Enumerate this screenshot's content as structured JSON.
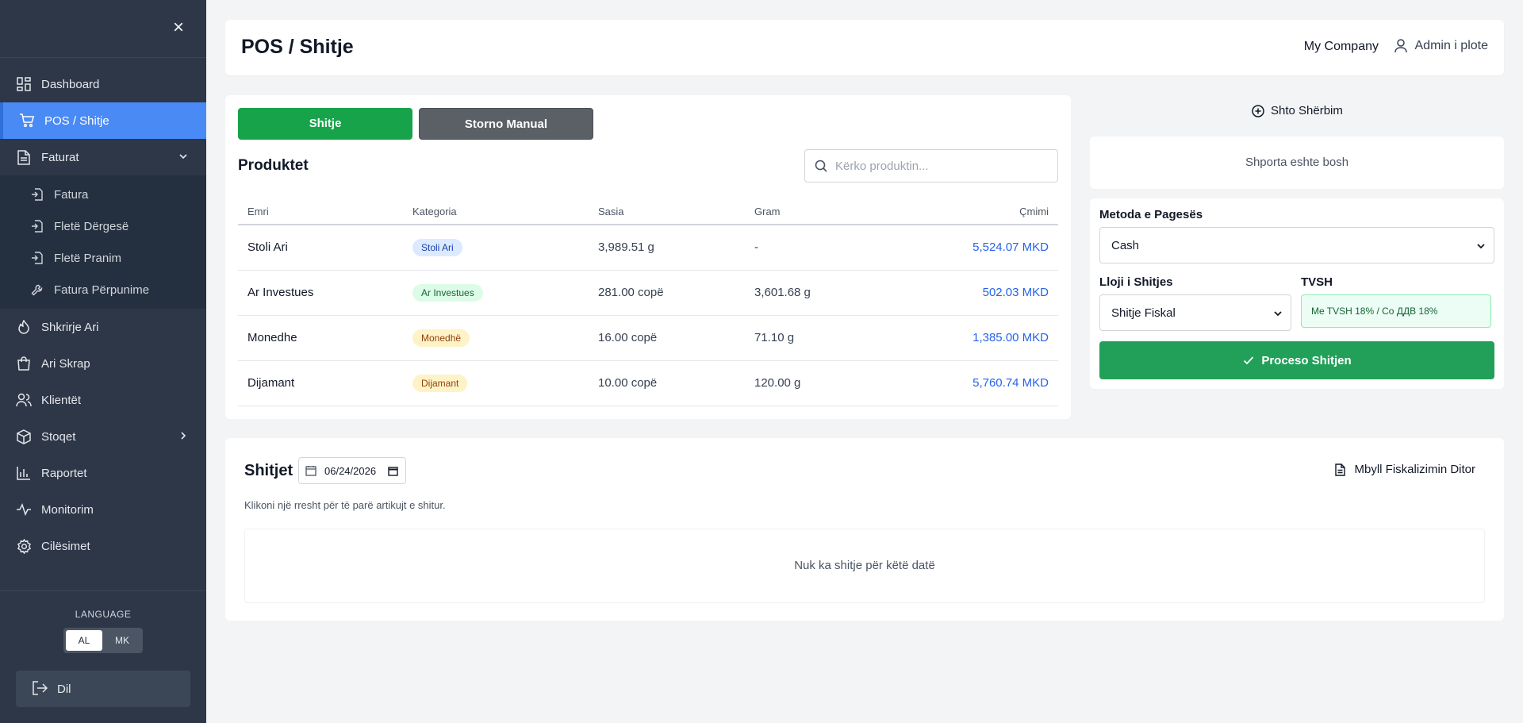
{
  "sidebar": {
    "items": [
      {
        "label": "Dashboard",
        "icon": "dashboard-icon"
      },
      {
        "label": "POS / Shitje",
        "icon": "cart-icon"
      },
      {
        "label": "Faturat",
        "icon": "document-icon"
      },
      {
        "label": "Shkrirje Ari",
        "icon": "flame-icon"
      },
      {
        "label": "Ari Skrap",
        "icon": "bag-icon"
      },
      {
        "label": "Klientët",
        "icon": "users-icon"
      },
      {
        "label": "Stoqet",
        "icon": "box-icon"
      },
      {
        "label": "Raportet",
        "icon": "bar-chart-icon"
      },
      {
        "label": "Monitorim",
        "icon": "activity-icon"
      },
      {
        "label": "Cilësimet",
        "icon": "gear-icon"
      }
    ],
    "faturat_sub": [
      {
        "label": "Fatura"
      },
      {
        "label": "Fletë Dërgesë"
      },
      {
        "label": "Fletë Pranim"
      },
      {
        "label": "Fatura Përpunime"
      }
    ],
    "language_label": "LANGUAGE",
    "languages": [
      "AL",
      "MK"
    ],
    "active_language": "AL",
    "logout_label": "Dil"
  },
  "header": {
    "title": "POS / Shitje",
    "company": "My Company",
    "user": "Admin i plote"
  },
  "pos": {
    "sale_button": "Shitje",
    "storno_button": "Storno Manual",
    "products_title": "Produktet",
    "search_placeholder": "Kërko produktin...",
    "columns": [
      "Emri",
      "Kategoria",
      "Sasia",
      "Gram",
      "Çmimi"
    ],
    "rows": [
      {
        "name": "Stoli Ari",
        "category": "Stoli Ari",
        "qty": "3,989.51 g",
        "gram": "-",
        "price": "5,524.07 MKD"
      },
      {
        "name": "Ar Investues",
        "category": "Ar Investues",
        "qty": "281.00 copë",
        "gram": "3,601.68 g",
        "price": "502.03 MKD"
      },
      {
        "name": "Monedhe",
        "category": "Monedhë",
        "qty": "16.00 copë",
        "gram": "71.10 g",
        "price": "1,385.00 MKD"
      },
      {
        "name": "Dijamant",
        "category": "Dijamant",
        "qty": "10.00 copë",
        "gram": "120.00 g",
        "price": "5,760.74 MKD"
      }
    ]
  },
  "cart": {
    "add_service": "Shto Shërbim",
    "empty_text": "Shporta eshte bosh",
    "payment_method_label": "Metoda e Pagesës",
    "payment_method_value": "Cash",
    "sale_type_label": "Lloji i Shitjes",
    "sale_type_value": "Shitje Fiskal",
    "tvsh_label": "TVSH",
    "tvsh_value": "Me TVSH 18% / Со ДДВ 18%",
    "process_button": "Proceso Shitjen"
  },
  "sales": {
    "title": "Shitjet",
    "date": "06/24/2026",
    "close_fiscal": "Mbyll Fiskalizimin Ditor",
    "hint": "Klikoni një rresht për të parë artikujt e shitur.",
    "empty_text": "Nuk ka shitje për këtë datë"
  },
  "colors": {
    "sidebar_bg": "#2d3748",
    "active_blue": "#4a8af4",
    "green": "#16a34a",
    "price_blue": "#2563eb"
  }
}
